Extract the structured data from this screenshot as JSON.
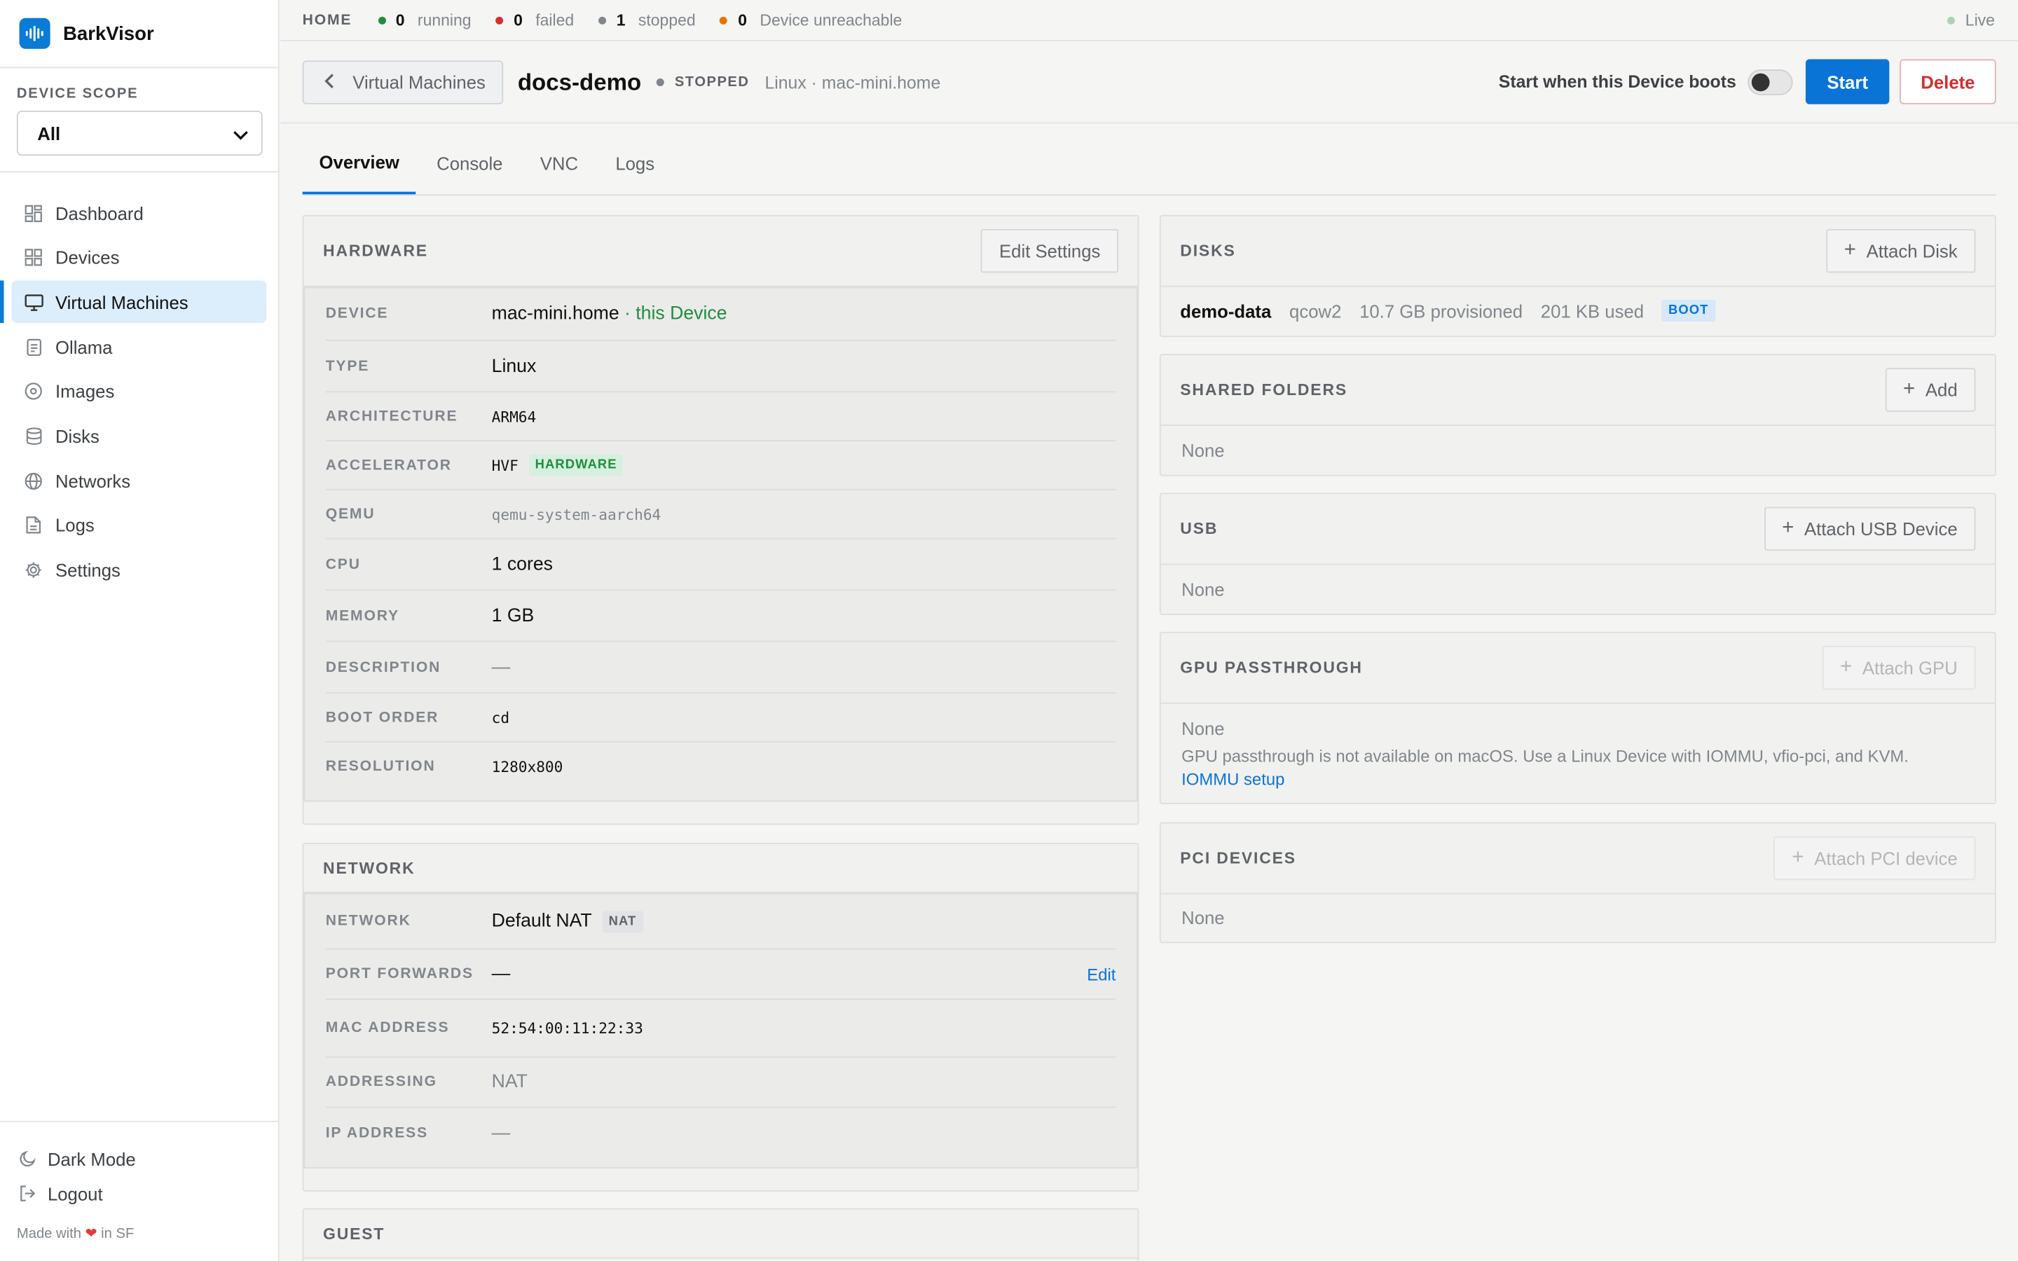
{
  "app": {
    "name": "BarkVisor"
  },
  "sidebar": {
    "scope_label": "DEVICE SCOPE",
    "scope_value": "All",
    "items": [
      {
        "label": "Dashboard",
        "icon": "dashboard-icon"
      },
      {
        "label": "Devices",
        "icon": "devices-icon"
      },
      {
        "label": "Virtual Machines",
        "icon": "monitor-icon",
        "active": true
      },
      {
        "label": "Ollama",
        "icon": "ollama-icon"
      },
      {
        "label": "Images",
        "icon": "disc-icon"
      },
      {
        "label": "Disks",
        "icon": "database-icon"
      },
      {
        "label": "Networks",
        "icon": "globe-icon"
      },
      {
        "label": "Logs",
        "icon": "file-icon"
      },
      {
        "label": "Settings",
        "icon": "gear-icon"
      }
    ],
    "dark_mode": "Dark Mode",
    "logout": "Logout",
    "made_prefix": "Made with",
    "made_suffix": "in SF"
  },
  "status": {
    "crumb": "HOME",
    "running_count": "0",
    "running_label": "running",
    "failed_count": "0",
    "failed_label": "failed",
    "stopped_count": "1",
    "stopped_label": "stopped",
    "unreachable_count": "0",
    "unreachable_label": "Device unreachable",
    "live": "Live",
    "colors": {
      "running": "#1e8e3e",
      "failed": "#d32f2f",
      "stopped": "#80868b",
      "unreachable": "#e37400",
      "live": "#a8d5b5"
    }
  },
  "header": {
    "back_label": "Virtual Machines",
    "vm_name": "docs-demo",
    "state": "STOPPED",
    "meta": "Linux · mac-mini.home",
    "autostart_label": "Start when this Device boots",
    "autostart_on": false,
    "start_label": "Start",
    "delete_label": "Delete"
  },
  "tabs": [
    "Overview",
    "Console",
    "VNC",
    "Logs"
  ],
  "hardware": {
    "title": "HARDWARE",
    "edit_label": "Edit Settings",
    "rows": {
      "device": {
        "label": "DEVICE",
        "value": "mac-mini.home",
        "note": "· this Device"
      },
      "type": {
        "label": "TYPE",
        "value": "Linux"
      },
      "architecture": {
        "label": "ARCHITECTURE",
        "value": "ARM64"
      },
      "accelerator": {
        "label": "ACCELERATOR",
        "value": "HVF",
        "badge": "HARDWARE"
      },
      "qemu": {
        "label": "QEMU",
        "value": "qemu-system-aarch64"
      },
      "cpu": {
        "label": "CPU",
        "value": "1 cores"
      },
      "memory": {
        "label": "MEMORY",
        "value": "1 GB"
      },
      "description": {
        "label": "DESCRIPTION",
        "value": "—"
      },
      "boot_order": {
        "label": "BOOT ORDER",
        "value": "cd"
      },
      "resolution": {
        "label": "RESOLUTION",
        "value": "1280x800"
      }
    }
  },
  "network": {
    "title": "NETWORK",
    "rows": {
      "network": {
        "label": "NETWORK",
        "value": "Default NAT",
        "badge": "NAT"
      },
      "port_forwards": {
        "label": "PORT FORWARDS",
        "value": "—",
        "edit": "Edit"
      },
      "mac": {
        "label": "MAC ADDRESS",
        "value": "52:54:00:11:22:33"
      },
      "addressing": {
        "label": "ADDRESSING",
        "value": "NAT"
      },
      "ip": {
        "label": "IP ADDRESS",
        "value": "—"
      }
    }
  },
  "guest": {
    "title": "GUEST"
  },
  "disks": {
    "title": "DISKS",
    "attach_label": "Attach Disk",
    "items": [
      {
        "name": "demo-data",
        "format": "qcow2",
        "provisioned": "10.7 GB provisioned",
        "used": "201 KB used",
        "badge": "BOOT"
      }
    ]
  },
  "shared_folders": {
    "title": "SHARED FOLDERS",
    "add_label": "Add",
    "empty": "None"
  },
  "usb": {
    "title": "USB",
    "attach_label": "Attach USB Device",
    "empty": "None"
  },
  "gpu": {
    "title": "GPU PASSTHROUGH",
    "attach_label": "Attach GPU",
    "empty": "None",
    "note": "GPU passthrough is not available on macOS. Use a Linux Device with IOMMU, vfio-pci, and KVM.",
    "link": "IOMMU setup"
  },
  "pci": {
    "title": "PCI DEVICES",
    "attach_label": "Attach PCI device",
    "empty": "None"
  }
}
